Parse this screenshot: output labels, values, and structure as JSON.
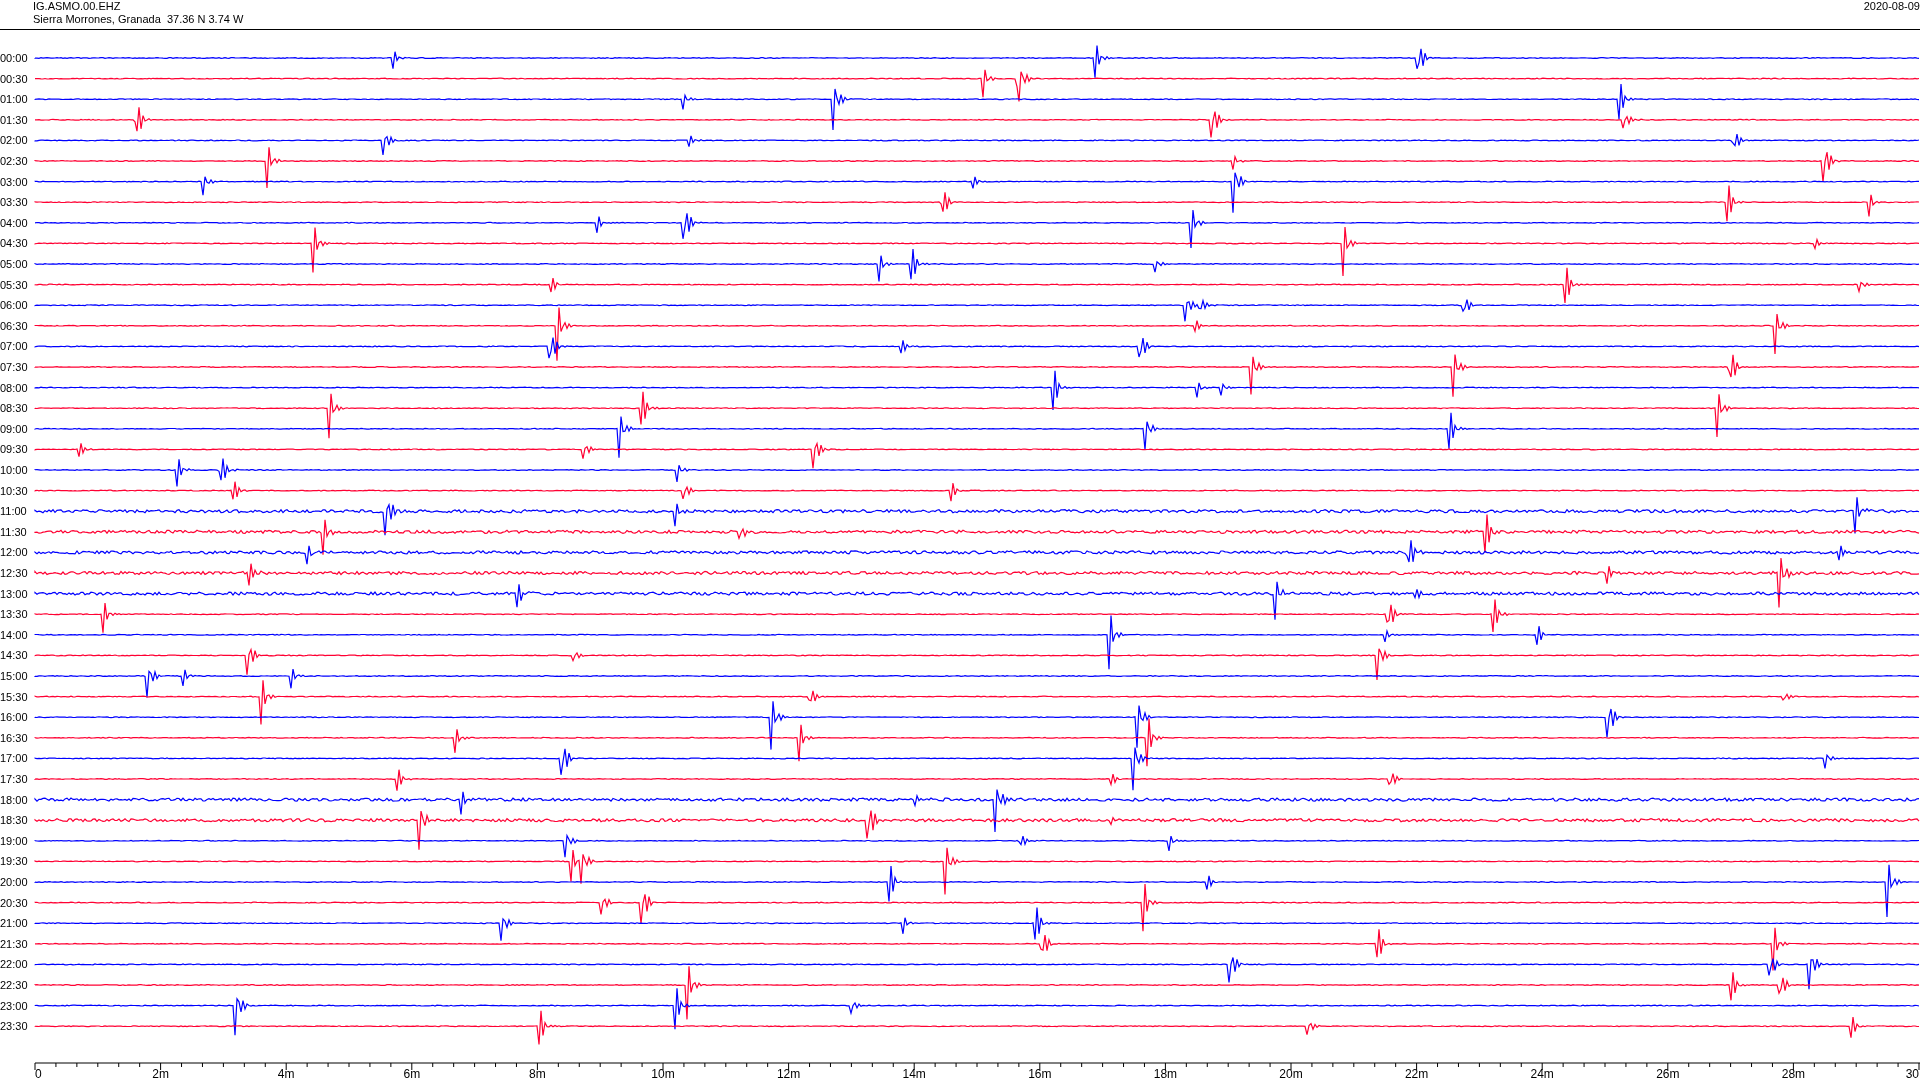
{
  "header": {
    "station": "IG.ASMO.00.EHZ",
    "location": "Sierra Morrones, Granada  37.36 N 3.74 W",
    "date": "2020-08-09"
  },
  "traces": [
    {
      "label": "00:00",
      "color": "#0000ff"
    },
    {
      "label": "00:30",
      "color": "#ff0033"
    },
    {
      "label": "01:00",
      "color": "#0000ff"
    },
    {
      "label": "01:30",
      "color": "#ff0033"
    },
    {
      "label": "02:00",
      "color": "#0000ff"
    },
    {
      "label": "02:30",
      "color": "#ff0033"
    },
    {
      "label": "03:00",
      "color": "#0000ff"
    },
    {
      "label": "03:30",
      "color": "#ff0033"
    },
    {
      "label": "04:00",
      "color": "#0000ff"
    },
    {
      "label": "04:30",
      "color": "#ff0033"
    },
    {
      "label": "05:00",
      "color": "#0000ff"
    },
    {
      "label": "05:30",
      "color": "#ff0033"
    },
    {
      "label": "06:00",
      "color": "#0000ff"
    },
    {
      "label": "06:30",
      "color": "#ff0033"
    },
    {
      "label": "07:00",
      "color": "#0000ff"
    },
    {
      "label": "07:30",
      "color": "#ff0033"
    },
    {
      "label": "08:00",
      "color": "#0000ff"
    },
    {
      "label": "08:30",
      "color": "#ff0033"
    },
    {
      "label": "09:00",
      "color": "#0000ff"
    },
    {
      "label": "09:30",
      "color": "#ff0033"
    },
    {
      "label": "10:00",
      "color": "#0000ff"
    },
    {
      "label": "10:30",
      "color": "#ff0033"
    },
    {
      "label": "11:00",
      "color": "#0000ff"
    },
    {
      "label": "11:30",
      "color": "#ff0033"
    },
    {
      "label": "12:00",
      "color": "#0000ff"
    },
    {
      "label": "12:30",
      "color": "#ff0033"
    },
    {
      "label": "13:00",
      "color": "#0000ff"
    },
    {
      "label": "13:30",
      "color": "#ff0033"
    },
    {
      "label": "14:00",
      "color": "#0000ff"
    },
    {
      "label": "14:30",
      "color": "#ff0033"
    },
    {
      "label": "15:00",
      "color": "#0000ff"
    },
    {
      "label": "15:30",
      "color": "#ff0033"
    },
    {
      "label": "16:00",
      "color": "#0000ff"
    },
    {
      "label": "16:30",
      "color": "#ff0033"
    },
    {
      "label": "17:00",
      "color": "#0000ff"
    },
    {
      "label": "17:30",
      "color": "#ff0033"
    },
    {
      "label": "18:00",
      "color": "#0000ff"
    },
    {
      "label": "18:30",
      "color": "#ff0033"
    },
    {
      "label": "19:00",
      "color": "#0000ff"
    },
    {
      "label": "19:30",
      "color": "#ff0033"
    },
    {
      "label": "20:00",
      "color": "#0000ff"
    },
    {
      "label": "20:30",
      "color": "#ff0033"
    },
    {
      "label": "21:00",
      "color": "#0000ff"
    },
    {
      "label": "21:30",
      "color": "#ff0033"
    },
    {
      "label": "22:00",
      "color": "#0000ff"
    },
    {
      "label": "22:30",
      "color": "#ff0033"
    },
    {
      "label": "23:00",
      "color": "#0000ff"
    },
    {
      "label": "23:30",
      "color": "#ff0033"
    }
  ],
  "x_axis": {
    "labels": [
      "0",
      "2m",
      "4m",
      "6m",
      "8m",
      "10m",
      "12m",
      "14m",
      "16m",
      "18m",
      "20m",
      "22m",
      "24m",
      "26m",
      "28m",
      "30"
    ]
  }
}
